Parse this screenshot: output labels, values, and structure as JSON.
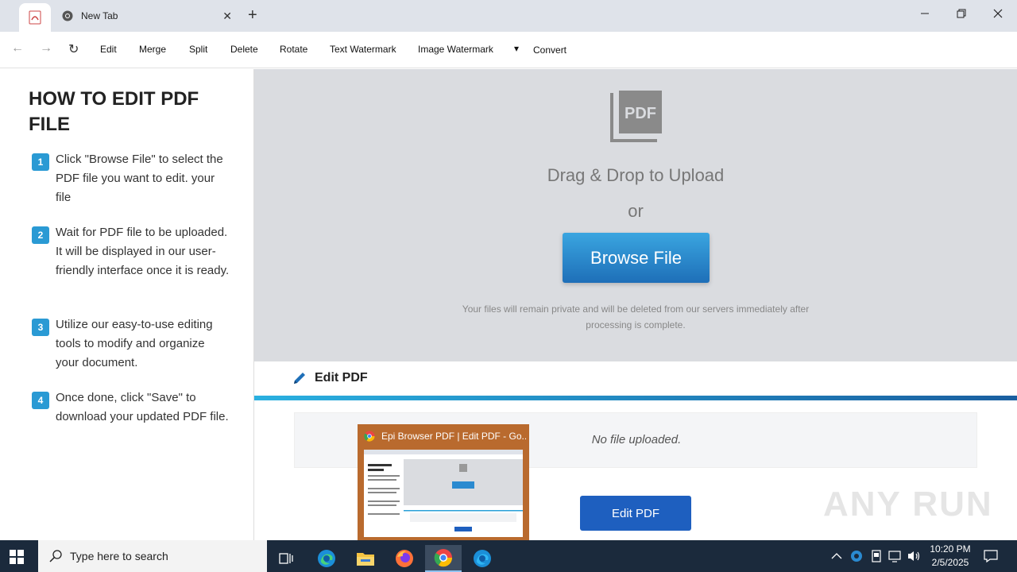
{
  "browser": {
    "tabs": [
      {
        "label": "",
        "icon": "pdf-tab-icon",
        "active": true
      },
      {
        "label": "New Tab",
        "icon": "chrome-icon",
        "active": false
      }
    ],
    "new_tab_symbol": "+",
    "close_symbol": "✕",
    "window_controls": {
      "minimize": "—",
      "maximize": "❐",
      "close": "✕"
    }
  },
  "toolbar": {
    "back_icon": "←",
    "forward_icon": "→",
    "reload_icon": "↻",
    "items": [
      "Edit",
      "Merge",
      "Split",
      "Delete",
      "Rotate",
      "Text Watermark",
      "Image Watermark"
    ],
    "dropdown_icon": "▾",
    "convert_label": "Convert"
  },
  "left_panel": {
    "title": "HOW TO EDIT PDF FILE",
    "steps": [
      {
        "num": "1",
        "text": "Click \"Browse File\" to select the PDF file you want to edit. your file"
      },
      {
        "num": "2",
        "text": "Wait for PDF file to be uploaded. It will be displayed in our user-friendly interface once it is ready."
      },
      {
        "num": "3",
        "text": "Utilize our easy-to-use editing tools to modify and organize your document."
      },
      {
        "num": "4",
        "text": "Once done, click \"Save\" to download your updated PDF file."
      }
    ]
  },
  "upload": {
    "icon_text": "PDF",
    "drag_text": "Drag & Drop to Upload",
    "or_text": "or",
    "browse_label": "Browse File",
    "privacy_text": "Your files will remain private and will be deleted from our servers immediately after processing is complete."
  },
  "edit_section": {
    "title": "Edit PDF",
    "no_file_text": "No file uploaded.",
    "edit_button_label": "Edit PDF"
  },
  "watermark": "ANY RUN",
  "thumbnail": {
    "title": "Epi Browser PDF | Edit PDF - Go..."
  },
  "taskbar": {
    "search_placeholder": "Type here to search",
    "time": "10:20 PM",
    "date": "2/5/2025"
  },
  "colors": {
    "accent_blue": "#2a9ad4",
    "button_blue": "#1e5fbf",
    "upload_bg": "#dadce0",
    "taskbar_bg": "#1b2a3c"
  }
}
